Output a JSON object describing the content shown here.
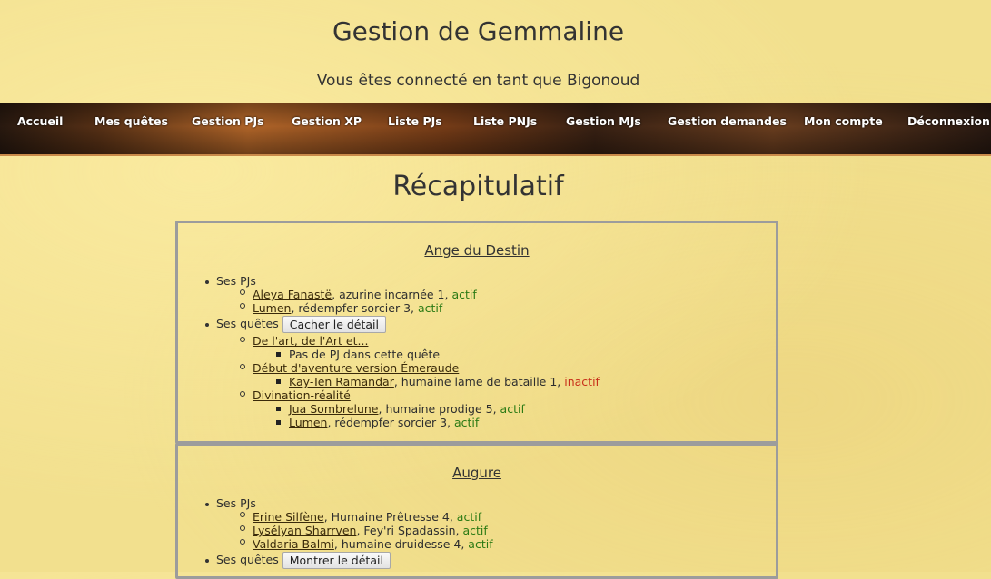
{
  "site_title": "Gestion de Gemmaline",
  "login_line": "Vous êtes connecté en tant que Bigonoud",
  "nav": [
    "Accueil",
    "Mes quêtes",
    "Gestion PJs",
    "Gestion XP",
    "Liste PJs",
    "Liste PNJs",
    "Gestion MJs",
    "Gestion demandes",
    "Mon compte",
    "Déconnexion"
  ],
  "page_heading": "Récapitulatif",
  "cards": [
    {
      "title": "Ange du Destin",
      "pjs_label": "Ses PJs",
      "pjs": [
        {
          "name": "Aleya Fanastë",
          "desc": ", azurine incarnée 1, ",
          "status": "actif"
        },
        {
          "name": "Lumen",
          "desc": ", rédempfer sorcier 3, ",
          "status": "actif"
        }
      ],
      "quests_label": "Ses quêtes",
      "quests_button": "Cacher le détail",
      "quests": [
        {
          "name": "De l'art, de l'Art et...",
          "entries": [
            {
              "text": "Pas de PJ dans cette quête"
            }
          ]
        },
        {
          "name": "Début d'aventure version Émeraude",
          "entries": [
            {
              "name": "Kay-Ten Ramandar",
              "desc": ", humaine lame de bataille 1, ",
              "status": "inactif"
            }
          ]
        },
        {
          "name": "Divination-réalité",
          "entries": [
            {
              "name": "Jua Sombrelune",
              "desc": ", humaine prodige 5, ",
              "status": "actif"
            },
            {
              "name": "Lumen",
              "desc": ", rédempfer sorcier 3, ",
              "status": "actif"
            }
          ]
        }
      ]
    },
    {
      "title": "Augure",
      "pjs_label": "Ses PJs",
      "pjs": [
        {
          "name": "Erine Silfène",
          "desc": ", Humaine Prêtresse 4, ",
          "status": "actif"
        },
        {
          "name": "Lysélyan Sharrven",
          "desc": ", Fey'ri Spadassin, ",
          "status": "actif"
        },
        {
          "name": "Valdaria Balmi",
          "desc": ", humaine druidesse 4, ",
          "status": "actif"
        }
      ],
      "quests_label": "Ses quêtes",
      "quests_button": "Montrer le détail"
    }
  ],
  "colors": {
    "active": "#2b7a14",
    "inactive": "#c8301a"
  }
}
